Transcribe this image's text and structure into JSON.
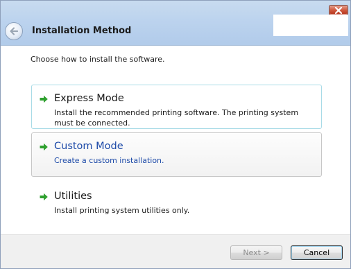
{
  "header": {
    "title": "Installation Method"
  },
  "instruction": "Choose how to install the software.",
  "options": [
    {
      "title": "Express Mode",
      "description": "Install the recommended printing software. The printing system must be connected."
    },
    {
      "title": "Custom Mode",
      "description": "Create a custom installation."
    },
    {
      "title": "Utilities",
      "description": "Install printing system utilities only."
    }
  ],
  "footer": {
    "next_label": "Next >",
    "cancel_label": "Cancel"
  },
  "icons": {
    "close": "close-icon",
    "back": "back-arrow-icon",
    "option_arrow": "green-arrow-icon"
  },
  "colors": {
    "header_blue": "#bcd3ee",
    "option_arrow_green": "#2fa02f",
    "custom_link_blue": "#1d4aa8",
    "footer_gray": "#f0f0f0"
  }
}
